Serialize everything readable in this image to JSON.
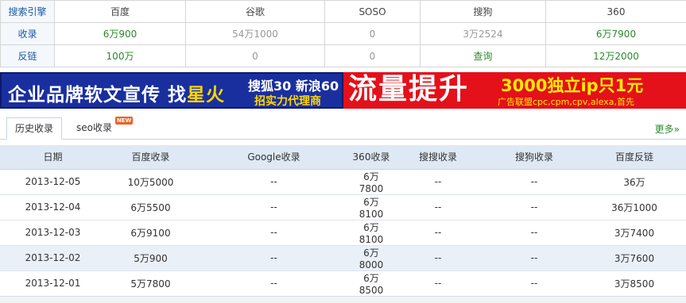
{
  "engine_table": {
    "headers": [
      "搜索引擎",
      "百度",
      "谷歌",
      "SOSO",
      "搜狗",
      "360"
    ],
    "rows": [
      {
        "label": "收录",
        "values": [
          "6万900",
          "54万1000",
          "0",
          "3万2524",
          "6万7900"
        ]
      },
      {
        "label": "反链",
        "values": [
          "100万",
          "0",
          "0",
          "查询",
          "12万2000"
        ]
      }
    ]
  },
  "banner": {
    "left_main": "企业品牌软文宣传 找",
    "left_hot": "星火",
    "left_line1": "搜狐30 新浪60",
    "left_line2": "招实力代理商",
    "right_main": "流量提升",
    "right_promo": "3000独立ip只1元",
    "right_sub": "广告联盟cpc,cpm,cpv,alexa,首先",
    "colors": {
      "blue": "#1a2f9e",
      "red": "#e4101a",
      "yellow": "#ffd700"
    }
  },
  "tabs": {
    "items": [
      "历史收录",
      "seo收录"
    ],
    "badge": "NEW",
    "more": "更多»"
  },
  "history": {
    "columns": [
      "日期",
      "百度收录",
      "Google收录",
      "360收录",
      "搜搜收录",
      "搜狗收录",
      "百度反链"
    ],
    "rows": [
      [
        "2013-12-05",
        "10万5000",
        "--",
        "6万7800",
        "--",
        "--",
        "36万"
      ],
      [
        "2013-12-04",
        "6万5500",
        "--",
        "6万8100",
        "--",
        "--",
        "36万1000"
      ],
      [
        "2013-12-03",
        "6万9100",
        "--",
        "6万8100",
        "--",
        "--",
        "3万7400"
      ],
      [
        "2013-12-02",
        "5万900",
        "--",
        "6万8000",
        "--",
        "--",
        "3万7600"
      ],
      [
        "2013-12-01",
        "5万7800",
        "--",
        "6万8500",
        "--",
        "--",
        "3万8500"
      ]
    ]
  }
}
